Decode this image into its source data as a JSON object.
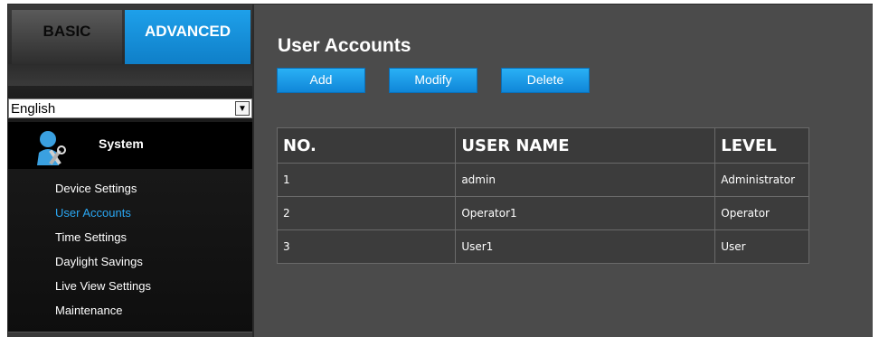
{
  "tabs": {
    "basic": "BASIC",
    "advanced": "ADVANCED"
  },
  "language": {
    "selected": "English"
  },
  "sidebar": {
    "section_title": "System",
    "items": [
      {
        "label": "Device Settings",
        "active": false
      },
      {
        "label": "User Accounts",
        "active": true
      },
      {
        "label": "Time Settings",
        "active": false
      },
      {
        "label": "Daylight Savings",
        "active": false
      },
      {
        "label": "Live View Settings",
        "active": false
      },
      {
        "label": "Maintenance",
        "active": false
      }
    ]
  },
  "main": {
    "title": "User Accounts",
    "buttons": {
      "add": "Add",
      "modify": "Modify",
      "delete": "Delete"
    },
    "table": {
      "headers": [
        "NO.",
        "USER NAME",
        "LEVEL"
      ],
      "rows": [
        [
          "1",
          "admin",
          "Administrator"
        ],
        [
          "2",
          "Operator1",
          "Operator"
        ],
        [
          "3",
          "User1",
          "User"
        ]
      ]
    }
  },
  "colors": {
    "accent": "#1ea0ea",
    "active_link": "#2aa7f3",
    "panel": "#4b4b4b"
  }
}
